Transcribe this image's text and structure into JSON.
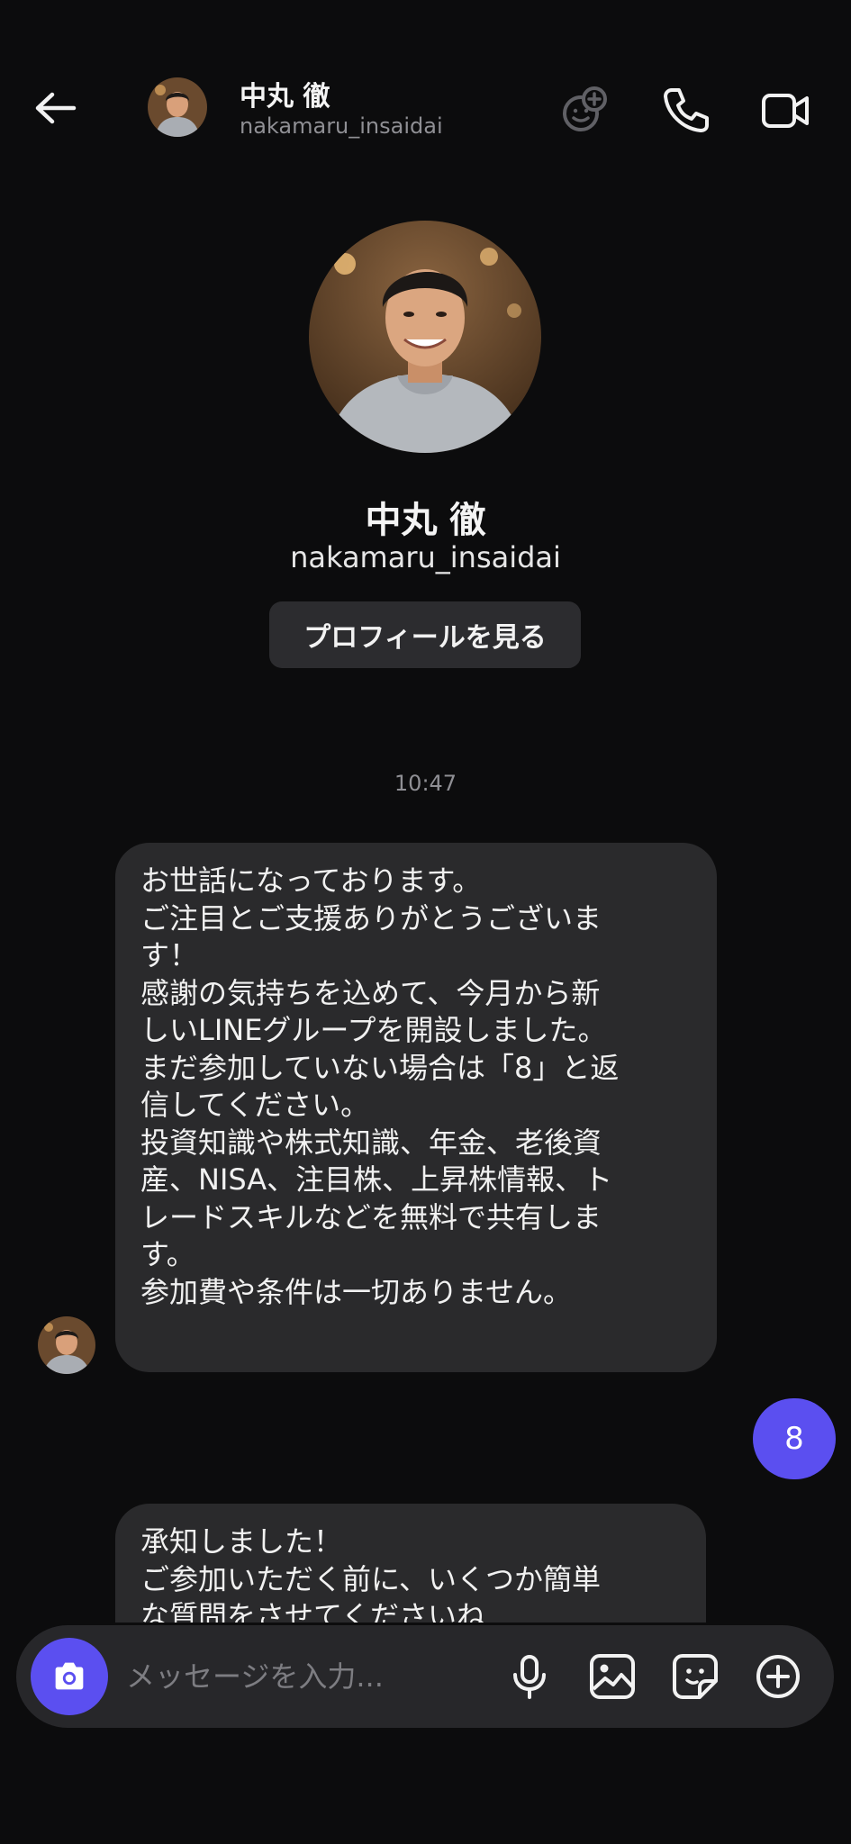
{
  "header": {
    "name": "中丸 徹",
    "username": "nakamaru_insaidai",
    "icons": [
      "back-arrow-icon",
      "add-friend-icon",
      "phone-icon",
      "video-call-icon"
    ]
  },
  "profile": {
    "name": "中丸 徹",
    "username": "nakamaru_insaidai",
    "view_profile_label": "プロフィールを見る"
  },
  "chat": {
    "timestamp": "10:47",
    "message1_lines": [
      "お世話になっております。",
      "ご注目とご支援ありがとうございま",
      "す！",
      "感謝の気持ちを込めて、今月から新",
      "しいLINEグループを開設しました。",
      "まだ参加していない場合は「8」と返",
      "信してください。",
      "投資知識や株式知識、年金、老後資",
      "産、NISA、注目株、上昇株情報、ト",
      "レードスキルなどを無料で共有しま",
      "す。",
      "参加費や条件は一切ありません。"
    ],
    "sent_message": "8",
    "message2_lines": [
      "承知しました！",
      "ご参加いただく前に、いくつか簡単",
      "な質問をさせてくださいね"
    ]
  },
  "composer": {
    "placeholder": "メッセージを入力...",
    "icons": [
      "camera-icon",
      "microphone-icon",
      "image-icon",
      "sticker-icon",
      "add-circle-icon"
    ]
  },
  "colors": {
    "background": "#0c0c0d",
    "bubble_incoming": "#2a2a2c",
    "accent": "#5b4ff0",
    "muted_text": "#8f8f94"
  }
}
